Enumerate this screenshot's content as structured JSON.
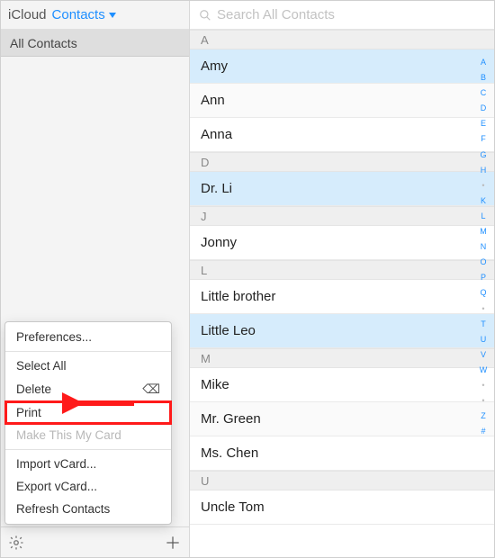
{
  "header": {
    "icloud": "iCloud",
    "contacts": "Contacts"
  },
  "sidebar": {
    "group": "All Contacts"
  },
  "search": {
    "placeholder": "Search All Contacts"
  },
  "sections": [
    {
      "letter": "A",
      "rows": [
        {
          "name": "Amy",
          "selected": true
        },
        {
          "name": "Ann",
          "selected": false
        },
        {
          "name": "Anna",
          "selected": false
        }
      ]
    },
    {
      "letter": "D",
      "rows": [
        {
          "name": "Dr. Li",
          "selected": true
        }
      ]
    },
    {
      "letter": "J",
      "rows": [
        {
          "name": "Jonny",
          "selected": false
        }
      ]
    },
    {
      "letter": "L",
      "rows": [
        {
          "name": "Little brother",
          "selected": false
        },
        {
          "name": "Little Leo",
          "selected": true
        }
      ]
    },
    {
      "letter": "M",
      "rows": [
        {
          "name": "Mike",
          "selected": false
        },
        {
          "name": "Mr. Green",
          "selected": false
        },
        {
          "name": "Ms. Chen",
          "selected": false
        }
      ]
    },
    {
      "letter": "U",
      "rows": [
        {
          "name": "Uncle Tom",
          "selected": false
        }
      ]
    }
  ],
  "alpha_index": [
    "A",
    "B",
    "C",
    "D",
    "E",
    "F",
    "G",
    "H",
    "•",
    "K",
    "L",
    "M",
    "N",
    "O",
    "P",
    "Q",
    "•",
    "T",
    "U",
    "V",
    "W",
    "•",
    "•",
    "Z",
    "#"
  ],
  "menu": {
    "preferences": "Preferences...",
    "select_all": "Select All",
    "delete": "Delete",
    "print": "Print",
    "make_card": "Make This My Card",
    "import_vcard": "Import vCard...",
    "export_vcard": "Export vCard...",
    "refresh": "Refresh Contacts"
  }
}
